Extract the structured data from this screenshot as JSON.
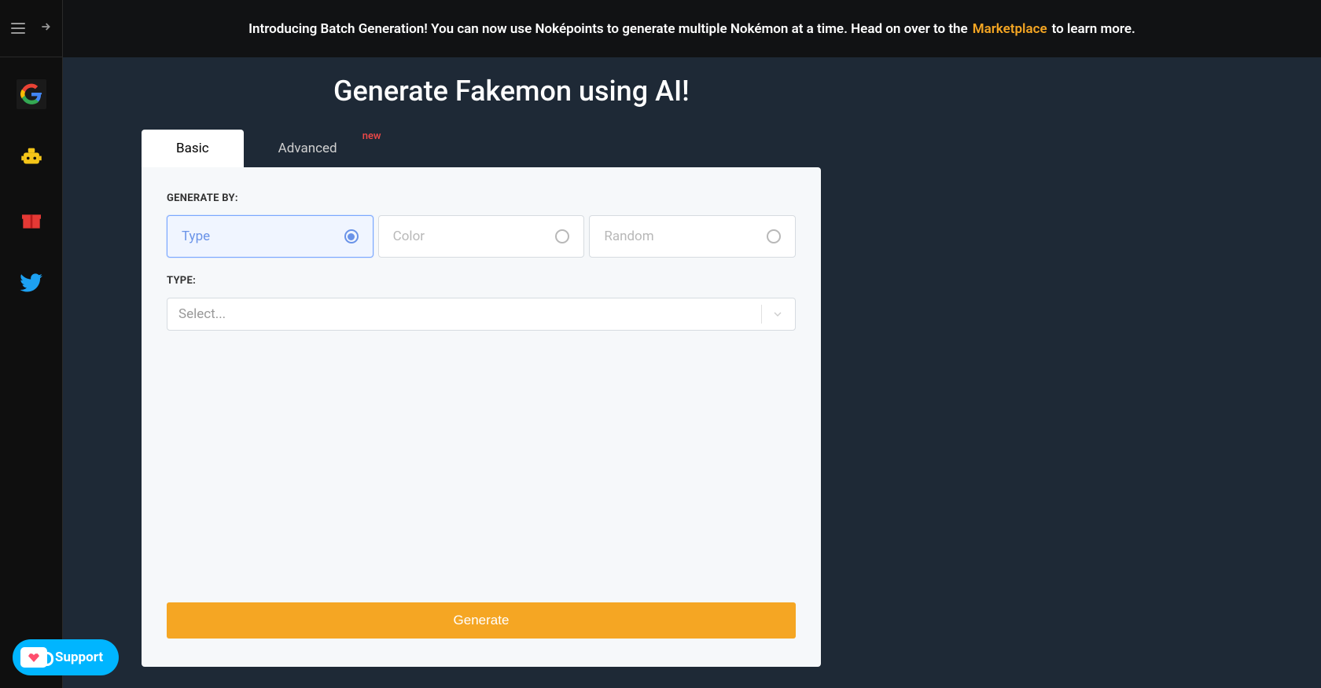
{
  "banner": {
    "prefix": "Introducing Batch Generation! You can now use Noképoints to generate multiple Nokémon at a time. Head on over to the",
    "link_text": "Marketplace",
    "suffix": "to learn more."
  },
  "page_title": "Generate Fakemon using AI!",
  "tabs": {
    "basic": "Basic",
    "advanced": "Advanced",
    "advanced_badge": "new"
  },
  "form": {
    "generate_by_label": "GENERATE BY:",
    "options": {
      "type": "Type",
      "color": "Color",
      "random": "Random"
    },
    "type_label": "TYPE:",
    "select_placeholder": "Select..."
  },
  "generate_button": "Generate",
  "support_label": "Support"
}
